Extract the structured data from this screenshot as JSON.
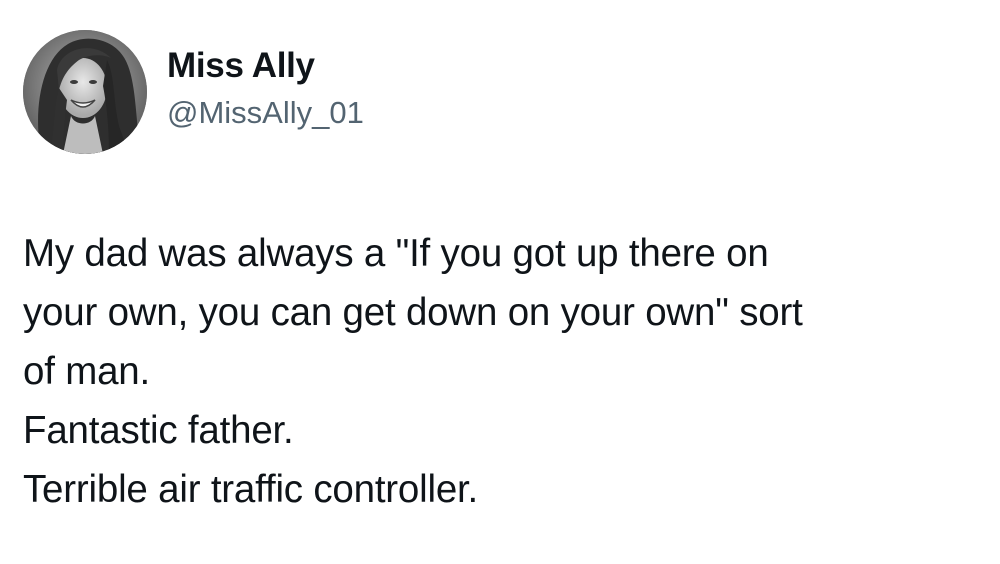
{
  "tweet": {
    "author": {
      "display_name": "Miss Ally",
      "handle": "@MissAlly_01"
    },
    "lines": [
      "My dad was always a \"If you got up there on",
      "your own, you can get down on your own\" sort",
      "of man.",
      "Fantastic father.",
      "Terrible air traffic controller."
    ]
  },
  "colors": {
    "text_primary": "#0f1419",
    "text_secondary": "#536471",
    "background": "#ffffff"
  }
}
